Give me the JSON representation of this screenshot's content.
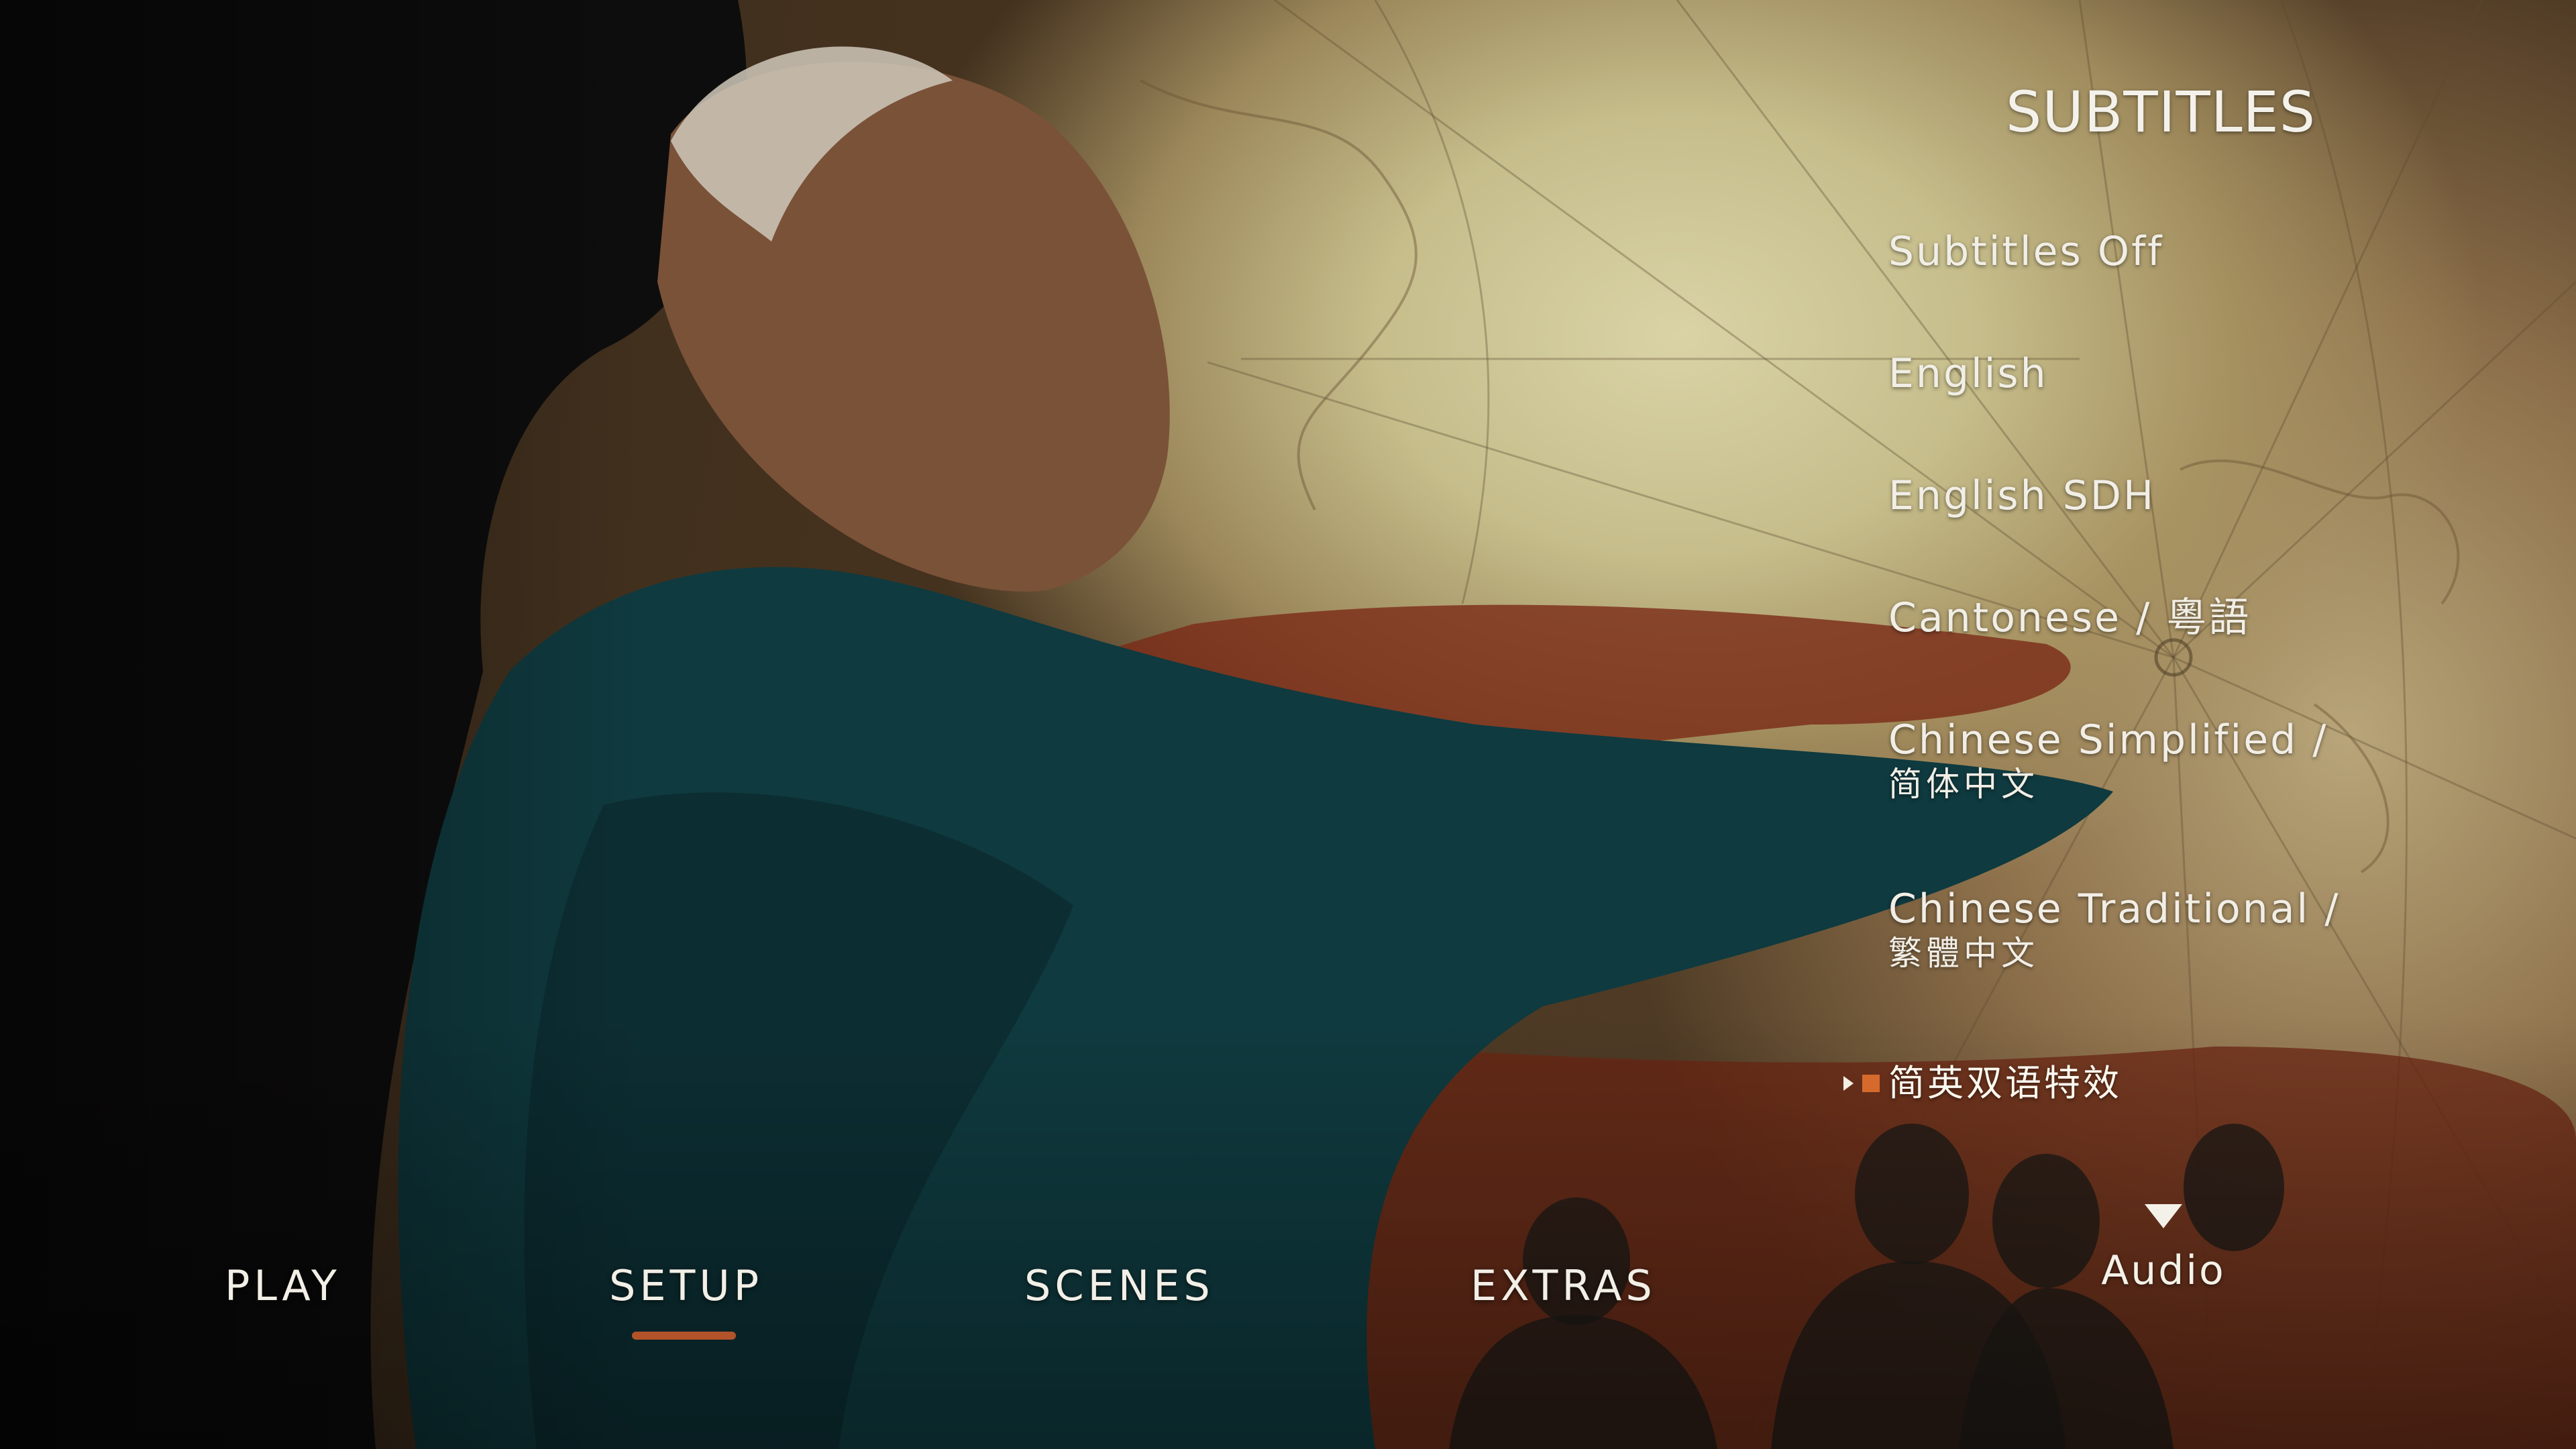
{
  "menu": {
    "title": "SUBTITLES",
    "options": [
      {
        "label": "Subtitles Off"
      },
      {
        "label": "English"
      },
      {
        "label": "English SDH"
      },
      {
        "label": "Cantonese / 粵語"
      },
      {
        "label": "Chinese Simplified /",
        "label_line2": "简体中文"
      },
      {
        "label": "Chinese Traditional /",
        "label_line2": "繁體中文"
      },
      {
        "label": "简英双语特效"
      }
    ],
    "selected_index": 6,
    "selection_icons": [
      "play-arrow-icon",
      "orange-square-icon"
    ],
    "selection_square_color": "#d66a2c",
    "next_menu": {
      "label": "Audio",
      "icon": "down-triangle-icon"
    }
  },
  "nav": {
    "items": [
      "PLAY",
      "SETUP",
      "SCENES",
      "EXTRAS"
    ],
    "active": "SETUP",
    "underline_color": "#b3532a"
  }
}
